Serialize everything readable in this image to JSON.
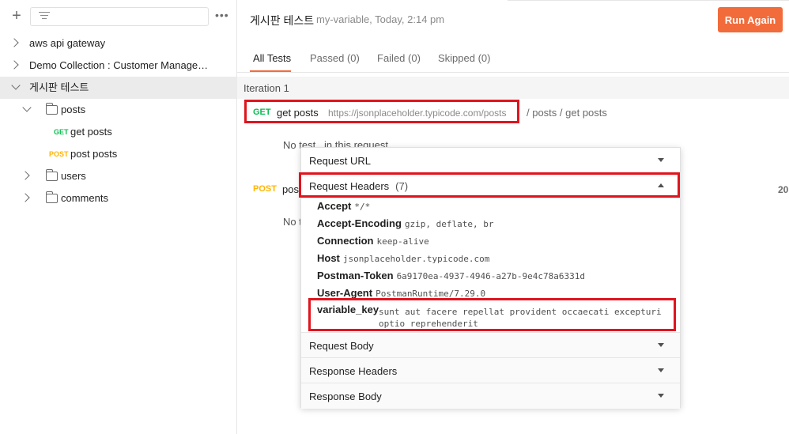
{
  "sidebar": {
    "items": [
      {
        "label": "aws api gateway"
      },
      {
        "label": "Demo Collection : Customer Managem..."
      },
      {
        "label": "게시판 테스트"
      },
      {
        "label": "posts"
      },
      {
        "label": "get posts",
        "method": "GET"
      },
      {
        "label": "post posts",
        "method": "POST"
      },
      {
        "label": "users"
      },
      {
        "label": "comments"
      }
    ]
  },
  "header": {
    "title": "게시판 테스트",
    "subtitle": "my-variable, Today, 2:14 pm",
    "run_again": "Run Again"
  },
  "tabs": [
    {
      "label": "All Tests"
    },
    {
      "label": "Passed (0)"
    },
    {
      "label": "Failed (0)"
    },
    {
      "label": "Skipped (0)"
    }
  ],
  "iteration": "Iteration 1",
  "requests": [
    {
      "method": "GET",
      "name": "get posts",
      "url": "https://jsonplaceholder.typicode.com/posts",
      "path": "/ posts / get posts",
      "no_test": "No test_ in this request."
    },
    {
      "method": "POST",
      "name": "pos",
      "no_test": "No t",
      "status": "20"
    }
  ],
  "popup": {
    "request_url": "Request URL",
    "request_headers": "Request Headers",
    "request_headers_count": "(7)",
    "headers": [
      {
        "key": "Accept",
        "value": "*/*"
      },
      {
        "key": "Accept-Encoding",
        "value": "gzip, deflate, br"
      },
      {
        "key": "Connection",
        "value": "keep-alive"
      },
      {
        "key": "Host",
        "value": "jsonplaceholder.typicode.com"
      },
      {
        "key": "Postman-Token",
        "value": "6a9170ea-4937-4946-a27b-9e4c78a6331d"
      },
      {
        "key": "User-Agent",
        "value": "PostmanRuntime/7.29.0"
      },
      {
        "key": "variable_key",
        "value": "sunt aut facere repellat provident occaecati excepturi optio reprehenderit"
      }
    ],
    "request_body": "Request Body",
    "response_headers": "Response Headers",
    "response_body": "Response Body"
  },
  "colors": {
    "accent": "#f26b3a",
    "get": "#0cbb52",
    "post": "#ffb400",
    "highlight": "#e0141e"
  }
}
